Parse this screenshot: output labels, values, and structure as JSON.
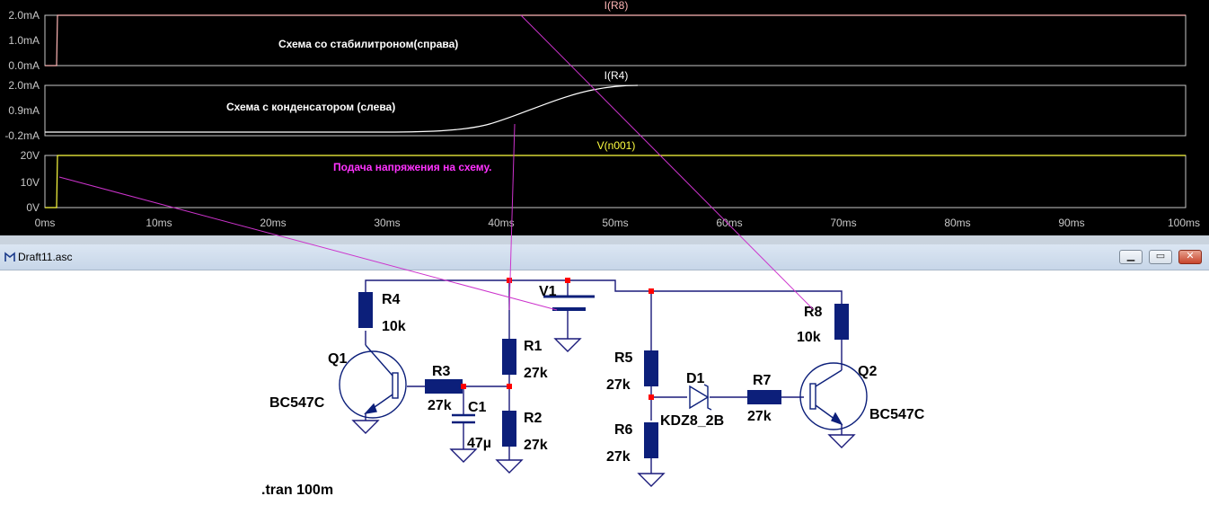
{
  "window": {
    "title": "Draft11.asc",
    "buttons": {
      "minimize": "▁",
      "restore": "▭",
      "close": "✕"
    }
  },
  "plot": {
    "panes": [
      {
        "trace_label": "I(R8)",
        "trace_color": "#ffb6b6",
        "y_ticks": [
          "2.0mA",
          "1.0mA",
          "0.0mA"
        ],
        "annotation": "Схема со стабилитроном(справа)",
        "annotation_color": "#ffffff"
      },
      {
        "trace_label": "I(R4)",
        "trace_color": "#ffffff",
        "y_ticks": [
          "2.0mA",
          "0.9mA",
          "-0.2mA"
        ],
        "annotation": "Схема с конденсатором (слева)",
        "annotation_color": "#ffffff"
      },
      {
        "trace_label": "V(n001)",
        "trace_color": "#ffff40",
        "y_ticks": [
          "20V",
          "10V",
          "0V"
        ],
        "annotation": "Подача напряжения на  схему.",
        "annotation_color": "#ff33ff"
      }
    ],
    "x_ticks": [
      "0ms",
      "10ms",
      "20ms",
      "30ms",
      "40ms",
      "50ms",
      "60ms",
      "70ms",
      "80ms",
      "90ms",
      "100ms"
    ]
  },
  "chart_data": [
    {
      "type": "line",
      "title": "I(R8)",
      "series": [
        {
          "name": "I(R8)",
          "x_ms": [
            0,
            1,
            1.05,
            100
          ],
          "y_mA": [
            0,
            0,
            2.0,
            2.0
          ]
        }
      ],
      "xlim_ms": [
        0,
        100
      ],
      "ylim_mA": [
        0,
        2.0
      ]
    },
    {
      "type": "line",
      "title": "I(R4)",
      "series": [
        {
          "name": "I(R4)",
          "x_ms": [
            0,
            30,
            35,
            38,
            40,
            42,
            45,
            48,
            50,
            52
          ],
          "y_mA": [
            -0.2,
            -0.2,
            -0.18,
            -0.1,
            0.05,
            0.3,
            0.9,
            1.6,
            1.9,
            2.0
          ]
        }
      ],
      "xlim_ms": [
        0,
        100
      ],
      "ylim_mA": [
        -0.2,
        2.0
      ]
    },
    {
      "type": "line",
      "title": "V(n001)",
      "series": [
        {
          "name": "V(n001)",
          "x_ms": [
            0,
            1,
            1.05,
            100
          ],
          "y_V": [
            0,
            0,
            20,
            20
          ]
        }
      ],
      "xlim_ms": [
        0,
        100
      ],
      "ylim_V": [
        0,
        20
      ]
    }
  ],
  "schematic": {
    "directive": ".tran 100m",
    "labels": {
      "R4": "R4",
      "R4_val": "10k",
      "Q1": "Q1",
      "Q1_model": "BC547C",
      "R3": "R3",
      "R3_val": "27k",
      "C1": "C1",
      "C1_val": "47µ",
      "R1": "R1",
      "R1_val": "27k",
      "R2": "R2",
      "R2_val": "27k",
      "V1": "V1",
      "R5": "R5",
      "R5_val": "27k",
      "R6": "R6",
      "R6_val": "27k",
      "D1": "D1",
      "D1_model": "KDZ8_2B",
      "R7": "R7",
      "R7_val": "27k",
      "R8": "R8",
      "R8_val": "10k",
      "Q2": "Q2",
      "Q2_model": "BC547C"
    },
    "colors": {
      "wire": "#1a1a7a",
      "component": "#0c1f7a",
      "junction": "#ff0000",
      "probe": "#cc33cc"
    }
  }
}
